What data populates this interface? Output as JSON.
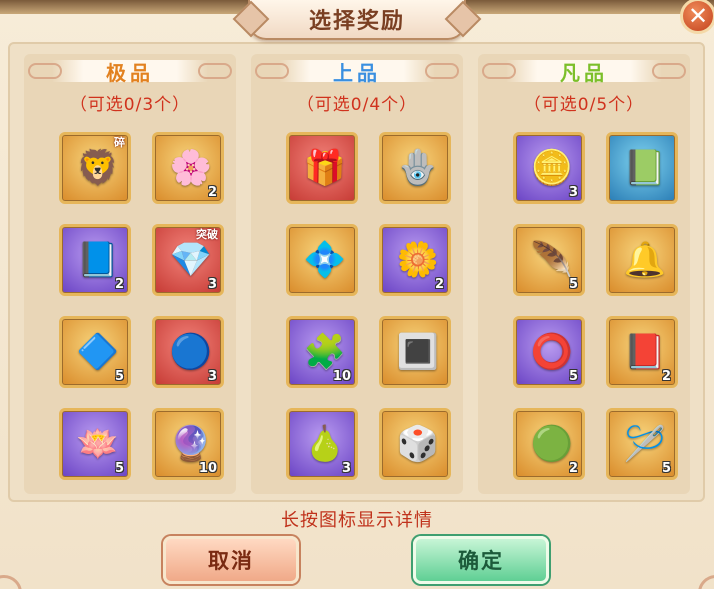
{
  "title": "选择奖励",
  "close_label": "✕",
  "columns": [
    {
      "name": "极品",
      "name_color": "#e2811f",
      "subtitle": "（可选0/3个）",
      "items": [
        {
          "icon": "white-lion-icon",
          "glyph": "🦁",
          "frame": "gold",
          "count": "",
          "tag": "碎"
        },
        {
          "icon": "golden-lotus-icon",
          "glyph": "🌸",
          "frame": "gold",
          "count": "2",
          "tag": ""
        },
        {
          "icon": "blue-book-icon",
          "glyph": "📘",
          "frame": "purple",
          "count": "2",
          "tag": ""
        },
        {
          "icon": "pink-crystal-icon",
          "glyph": "💎",
          "frame": "red",
          "count": "3",
          "tag": "突破"
        },
        {
          "icon": "purple-crystal-icon",
          "glyph": "🔷",
          "frame": "gold",
          "count": "5",
          "tag": ""
        },
        {
          "icon": "blue-orb-icon",
          "glyph": "🔵",
          "frame": "red",
          "count": "3",
          "tag": ""
        },
        {
          "icon": "pink-lotus-icon",
          "glyph": "🪷",
          "frame": "purple",
          "count": "5",
          "tag": ""
        },
        {
          "icon": "purple-flame-icon",
          "glyph": "🔮",
          "frame": "gold",
          "count": "10",
          "tag": ""
        }
      ]
    },
    {
      "name": "上品",
      "name_color": "#3a8fe0",
      "subtitle": "（可选0/4个）",
      "items": [
        {
          "icon": "pink-cake-box-icon",
          "glyph": "🎁",
          "frame": "red",
          "count": "",
          "tag": ""
        },
        {
          "icon": "jade-pendant-icon",
          "glyph": "🪬",
          "frame": "gold",
          "count": "",
          "tag": ""
        },
        {
          "icon": "blue-crystal-icon",
          "glyph": "💠",
          "frame": "gold",
          "count": "",
          "tag": ""
        },
        {
          "icon": "white-flower-icon",
          "glyph": "🌼",
          "frame": "purple",
          "count": "2",
          "tag": ""
        },
        {
          "icon": "puzzle-piece-icon",
          "glyph": "🧩",
          "frame": "purple",
          "count": "10",
          "tag": ""
        },
        {
          "icon": "mirror-frame-icon",
          "glyph": "🔳",
          "frame": "gold",
          "count": "",
          "tag": ""
        },
        {
          "icon": "jade-gourd-icon",
          "glyph": "🍐",
          "frame": "purple",
          "count": "3",
          "tag": ""
        },
        {
          "icon": "dice-pouch-icon",
          "glyph": "🎲",
          "frame": "gold",
          "count": "",
          "tag": ""
        }
      ]
    },
    {
      "name": "凡品",
      "name_color": "#7cbf2a",
      "subtitle": "（可选0/5个）",
      "items": [
        {
          "icon": "jade-token-icon",
          "glyph": "🪙",
          "frame": "purple",
          "count": "3",
          "tag": ""
        },
        {
          "icon": "blue-scroll-book-icon",
          "glyph": "📗",
          "frame": "blue",
          "count": "",
          "tag": ""
        },
        {
          "icon": "pink-feather-icon",
          "glyph": "🪶",
          "frame": "gold",
          "count": "5",
          "tag": ""
        },
        {
          "icon": "bronze-bells-icon",
          "glyph": "🔔",
          "frame": "gold",
          "count": "",
          "tag": ""
        },
        {
          "icon": "jade-ring-icon",
          "glyph": "⭕",
          "frame": "purple",
          "count": "5",
          "tag": ""
        },
        {
          "icon": "red-book-icon",
          "glyph": "📕",
          "frame": "gold",
          "count": "2",
          "tag": ""
        },
        {
          "icon": "teal-orb-icon",
          "glyph": "🟢",
          "frame": "gold",
          "count": "2",
          "tag": ""
        },
        {
          "icon": "needle-thread-icon",
          "glyph": "🪡",
          "frame": "gold",
          "count": "5",
          "tag": ""
        }
      ]
    }
  ],
  "hint": "长按图标显示详情",
  "buttons": {
    "cancel": "取消",
    "ok": "确定"
  }
}
